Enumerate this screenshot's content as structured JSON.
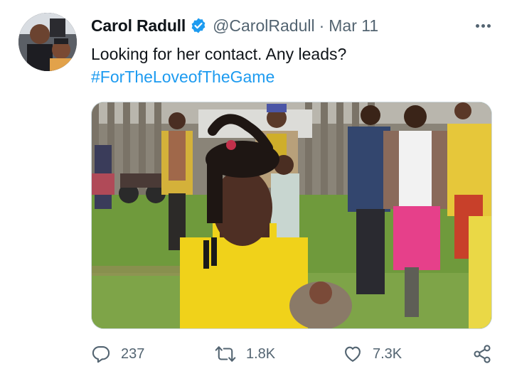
{
  "tweet": {
    "author": {
      "display_name": "Carol Radull",
      "handle": "@CarolRadull",
      "verified": true
    },
    "separator": "·",
    "date": "Mar 11",
    "text": "Looking for her contact. Any leads?",
    "hashtag": "#ForTheLoveofTheGame",
    "more_icon": "more-horizontal-icon",
    "actions": {
      "reply": {
        "icon": "reply-icon",
        "count": "237"
      },
      "retweet": {
        "icon": "retweet-icon",
        "count": "1.8K"
      },
      "like": {
        "icon": "heart-icon",
        "count": "7.3K"
      },
      "share": {
        "icon": "share-icon"
      }
    }
  },
  "colors": {
    "text": "#0f1419",
    "secondary": "#536471",
    "link": "#1d9bf0",
    "verified": "#1d9bf0"
  }
}
